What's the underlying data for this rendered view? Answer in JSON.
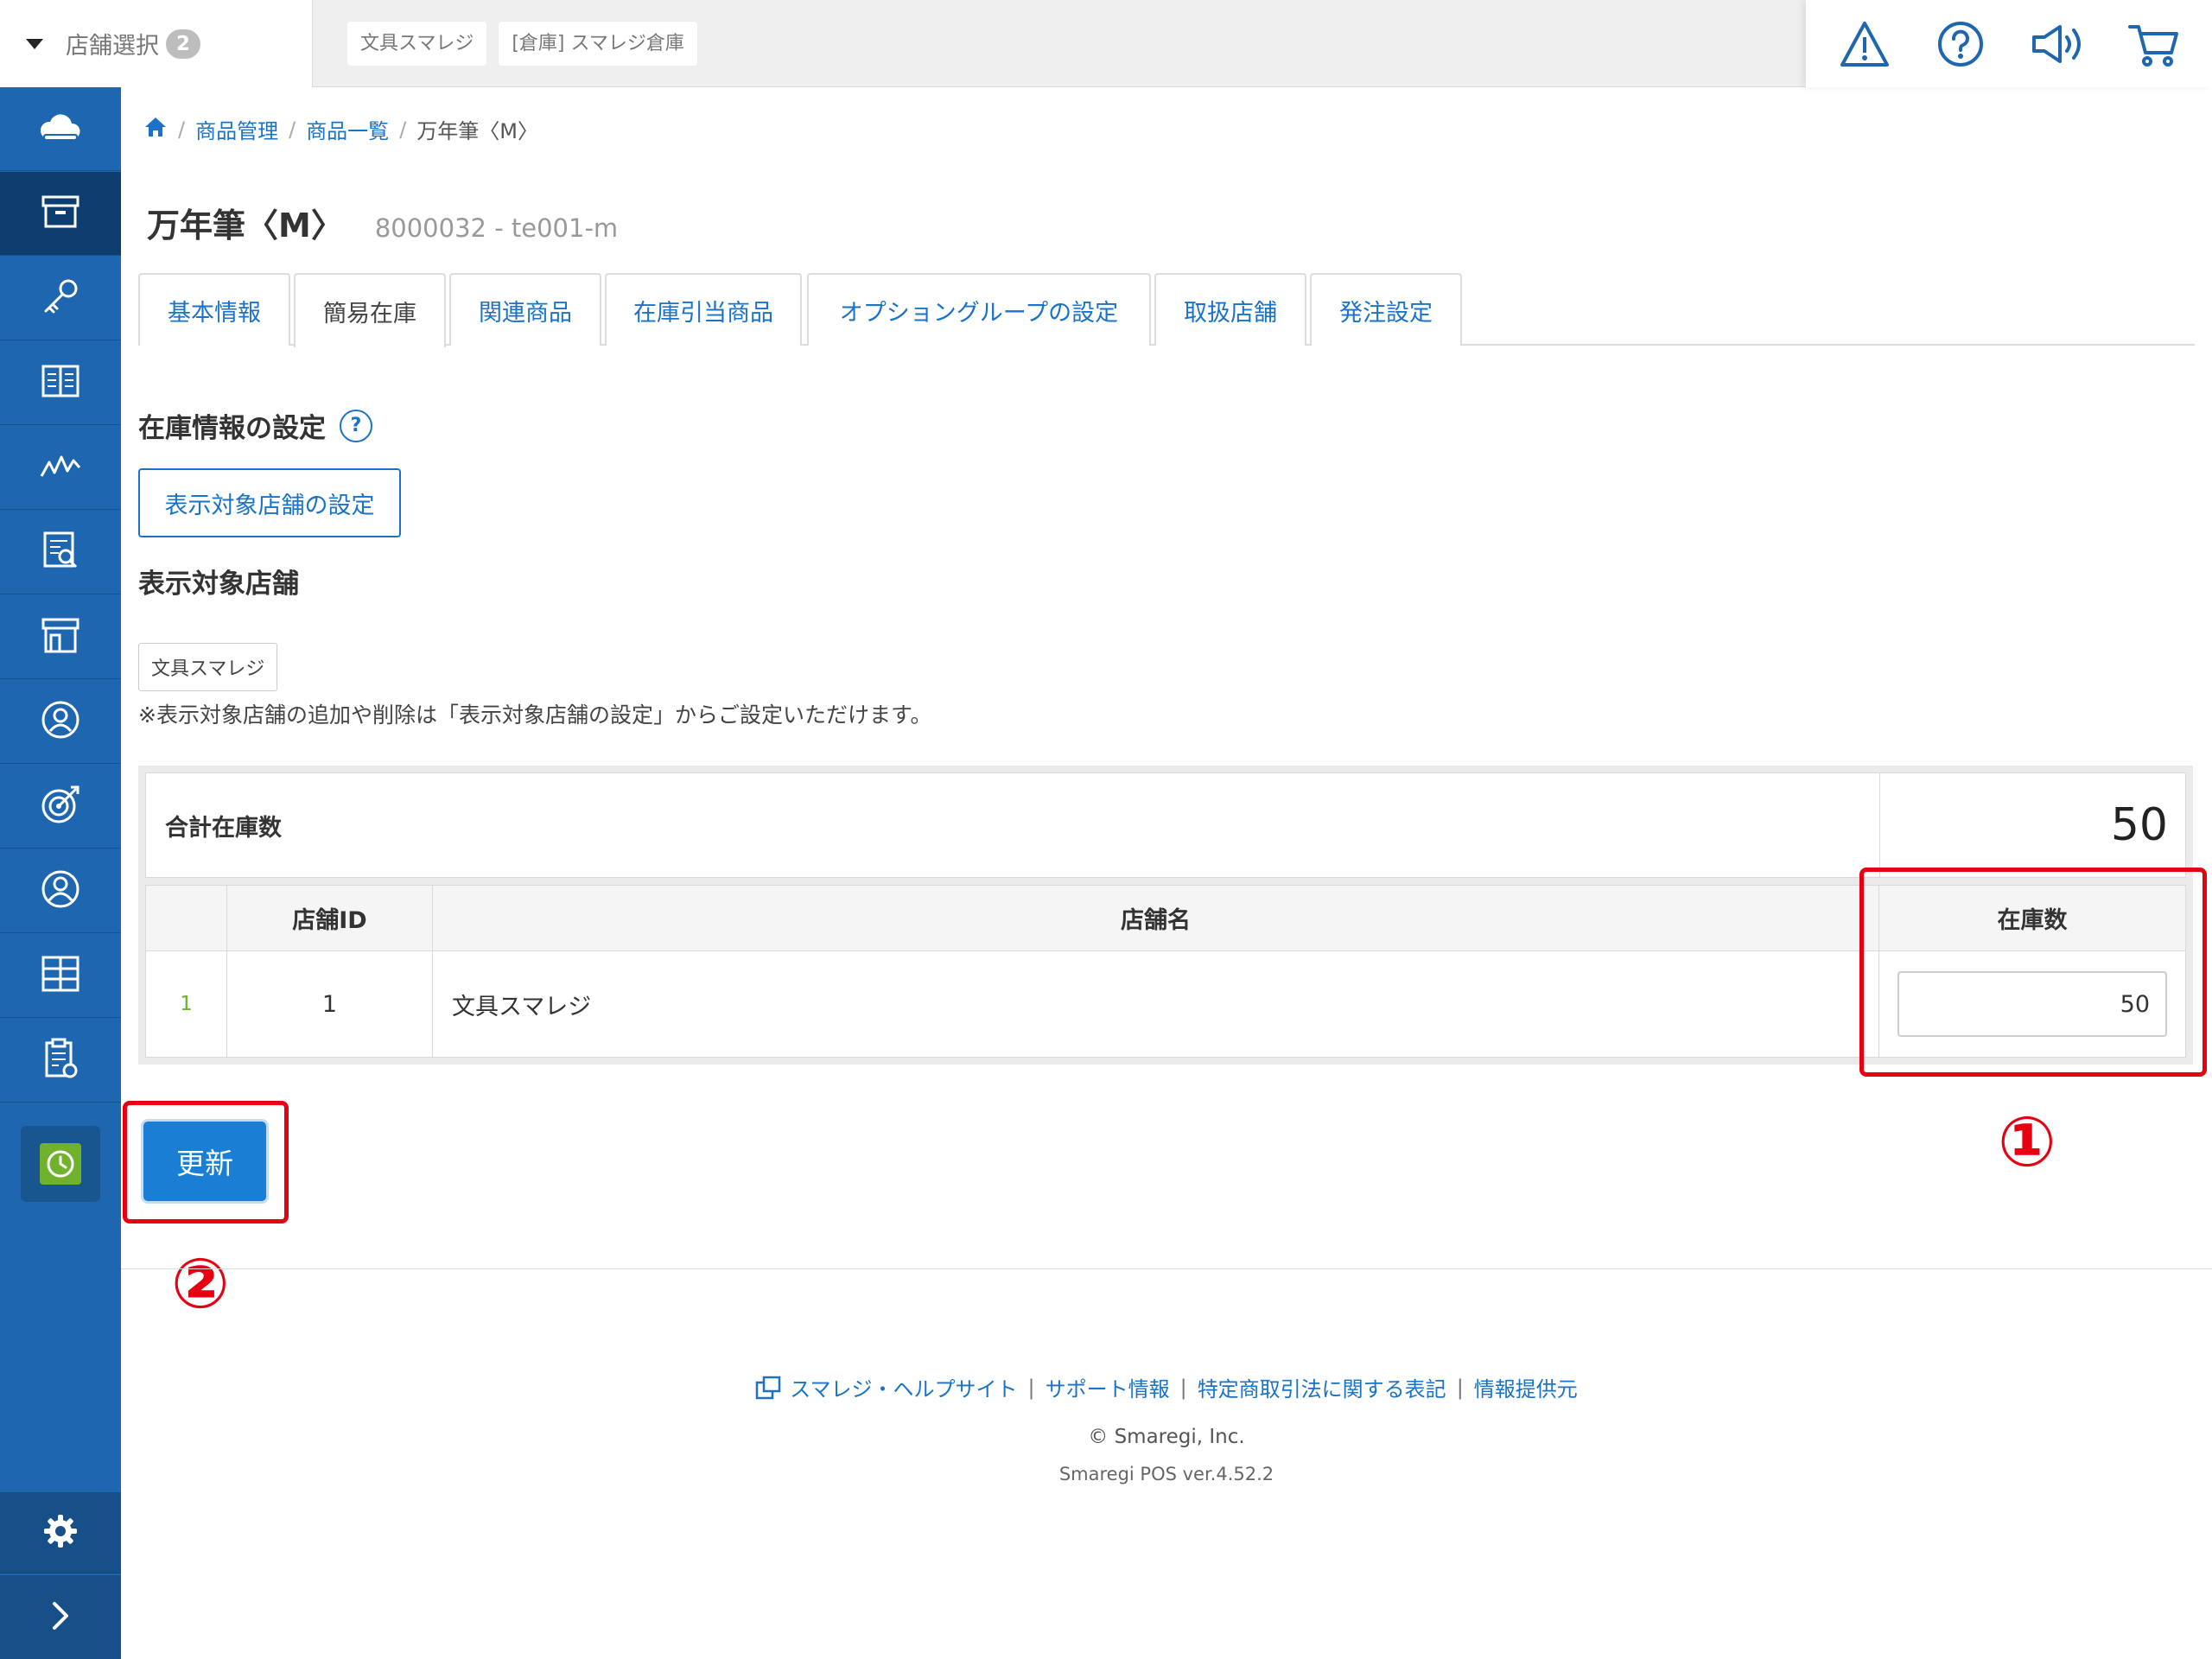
{
  "topbar": {
    "store_select_label": "店舗選択",
    "store_count": "2",
    "stores": [
      "文具スマレジ",
      "[倉庫] スマレジ倉庫"
    ],
    "icons": [
      "warning-icon",
      "help-icon",
      "megaphone-icon",
      "cart-icon"
    ]
  },
  "sidebar": {
    "icons": [
      "cloud-icon",
      "box-icon",
      "key-icon",
      "ledger-icon",
      "trend-icon",
      "report-icon",
      "store-icon",
      "customer-icon",
      "target-icon",
      "staff-icon",
      "grid-icon",
      "clipboard-icon",
      "clock-icon",
      "gear-icon",
      "chevron-right-icon"
    ]
  },
  "breadcrumb": {
    "items": [
      "商品管理",
      "商品一覧"
    ],
    "current": "万年筆〈M〉"
  },
  "product": {
    "name": "万年筆〈M〉",
    "code": "8000032 - te001-m"
  },
  "tabs": [
    "基本情報",
    "簡易在庫",
    "関連商品",
    "在庫引当商品",
    "オプショングループの設定",
    "取扱店舗",
    "発注設定"
  ],
  "active_tab": "簡易在庫",
  "stock_settings": {
    "title": "在庫情報の設定",
    "help": "?",
    "display_store_button": "表示対象店舗の設定",
    "display_store_title": "表示対象店舗",
    "display_stores": [
      "文具スマレジ"
    ],
    "note": "※表示対象店舗の追加や削除は「表示対象店舗の設定」からご設定いただけます。"
  },
  "table": {
    "total_label": "合計在庫数",
    "total_value": "50",
    "headers": {
      "store_id": "店舗ID",
      "store_name": "店舗名",
      "stock": "在庫数"
    },
    "rows": [
      {
        "index": "1",
        "store_id": "1",
        "store_name": "文具スマレジ",
        "stock": "50"
      }
    ]
  },
  "update_button": "更新",
  "annotations": {
    "one": "①",
    "two": "②",
    "color": "#e60012"
  },
  "footer": {
    "links": [
      "スマレジ・ヘルプサイト",
      "サポート情報",
      "特定商取引法に関する表記",
      "情報提供元"
    ],
    "copyright": "© Smaregi, Inc.",
    "version": "Smaregi POS ver.4.52.2"
  },
  "colors": {
    "sidebar": "#1e67b0",
    "link": "#1a73c8",
    "primary_button": "#1a7fd4",
    "accent_green": "#71b22d"
  }
}
